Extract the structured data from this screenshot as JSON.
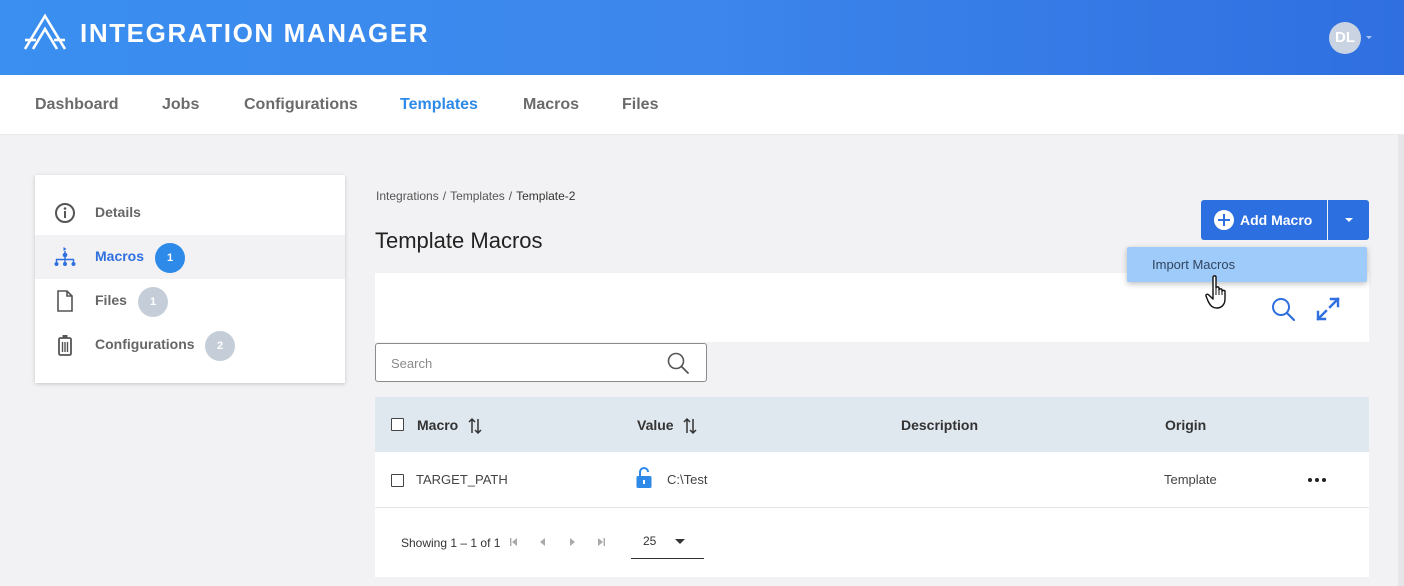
{
  "app": {
    "title": "INTEGRATION MANAGER",
    "user_initials": "DL"
  },
  "nav": {
    "items": [
      {
        "label": "Dashboard"
      },
      {
        "label": "Jobs"
      },
      {
        "label": "Configurations"
      },
      {
        "label": "Templates",
        "active": true
      },
      {
        "label": "Macros"
      },
      {
        "label": "Files"
      }
    ]
  },
  "sidebar": {
    "items": [
      {
        "label": "Details",
        "icon": "info-icon"
      },
      {
        "label": "Macros",
        "icon": "macro-tree-icon",
        "badge": "1",
        "active": true
      },
      {
        "label": "Files",
        "icon": "file-icon",
        "badge": "1"
      },
      {
        "label": "Configurations",
        "icon": "configuration-icon",
        "badge": "2"
      }
    ]
  },
  "breadcrumb": {
    "items": [
      "Integrations",
      "Templates"
    ],
    "current": "Template-2",
    "separator": "/"
  },
  "page": {
    "title": "Template Macros"
  },
  "actions": {
    "add_label": "Add Macro",
    "menu_item": "Import Macros"
  },
  "search": {
    "placeholder": "Search"
  },
  "table": {
    "columns": [
      "Macro",
      "Value",
      "Description",
      "Origin"
    ],
    "rows": [
      {
        "macro": "TARGET_PATH",
        "value": "C:\\Test",
        "description": "",
        "origin": "Template",
        "locked": false
      }
    ]
  },
  "pagination": {
    "summary": "Showing 1 – 1 of 1",
    "page_size": "25"
  },
  "colors": {
    "accent": "#2d8ae8",
    "header_gradient_start": "#3a8ff0",
    "header_gradient_end": "#2f6fe0",
    "menu_highlight": "#9ecbfa"
  }
}
